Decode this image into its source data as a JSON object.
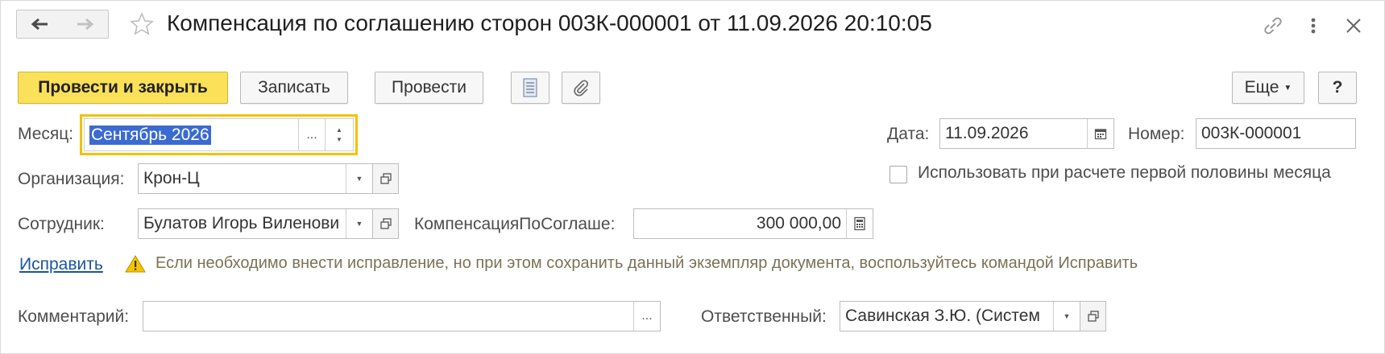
{
  "header": {
    "title": "Компенсация по соглашению сторон 003К-000001 от 11.09.2026 20:10:05"
  },
  "toolbar": {
    "post_and_close": "Провести и закрыть",
    "save": "Записать",
    "post": "Провести",
    "more": "Еще",
    "help": "?"
  },
  "form": {
    "month": {
      "label": "Месяц:",
      "value": "Сентябрь 2026",
      "select_glyph": "..."
    },
    "date": {
      "label": "Дата:",
      "value": "11.09.2026"
    },
    "number": {
      "label": "Номер:",
      "value": "003К-000001"
    },
    "organization": {
      "label": "Организация:",
      "value": "Крон-Ц"
    },
    "first_half_checkbox": {
      "label": "Использовать при расчете первой половины месяца",
      "checked": false
    },
    "employee": {
      "label": "Сотрудник:",
      "value": "Булатов Игорь Виленови"
    },
    "compensation": {
      "label": "КомпенсацияПоСоглаше:",
      "value": "300 000,00"
    },
    "fix": {
      "link": "Исправить",
      "message": "Если необходимо внести исправление, но при этом сохранить данный экземпляр документа, воспользуйтесь командой Исправить"
    },
    "comment": {
      "label": "Комментарий:",
      "value": "",
      "select_glyph": "..."
    },
    "responsible": {
      "label": "Ответственный:",
      "value": "Савинская З.Ю. (Систем"
    }
  },
  "colors": {
    "primary_button": "#fbe05a",
    "focus_border": "#f2c200",
    "selection": "#3b6bd1",
    "link": "#1b55a0",
    "warning_icon": "#f5c400"
  }
}
